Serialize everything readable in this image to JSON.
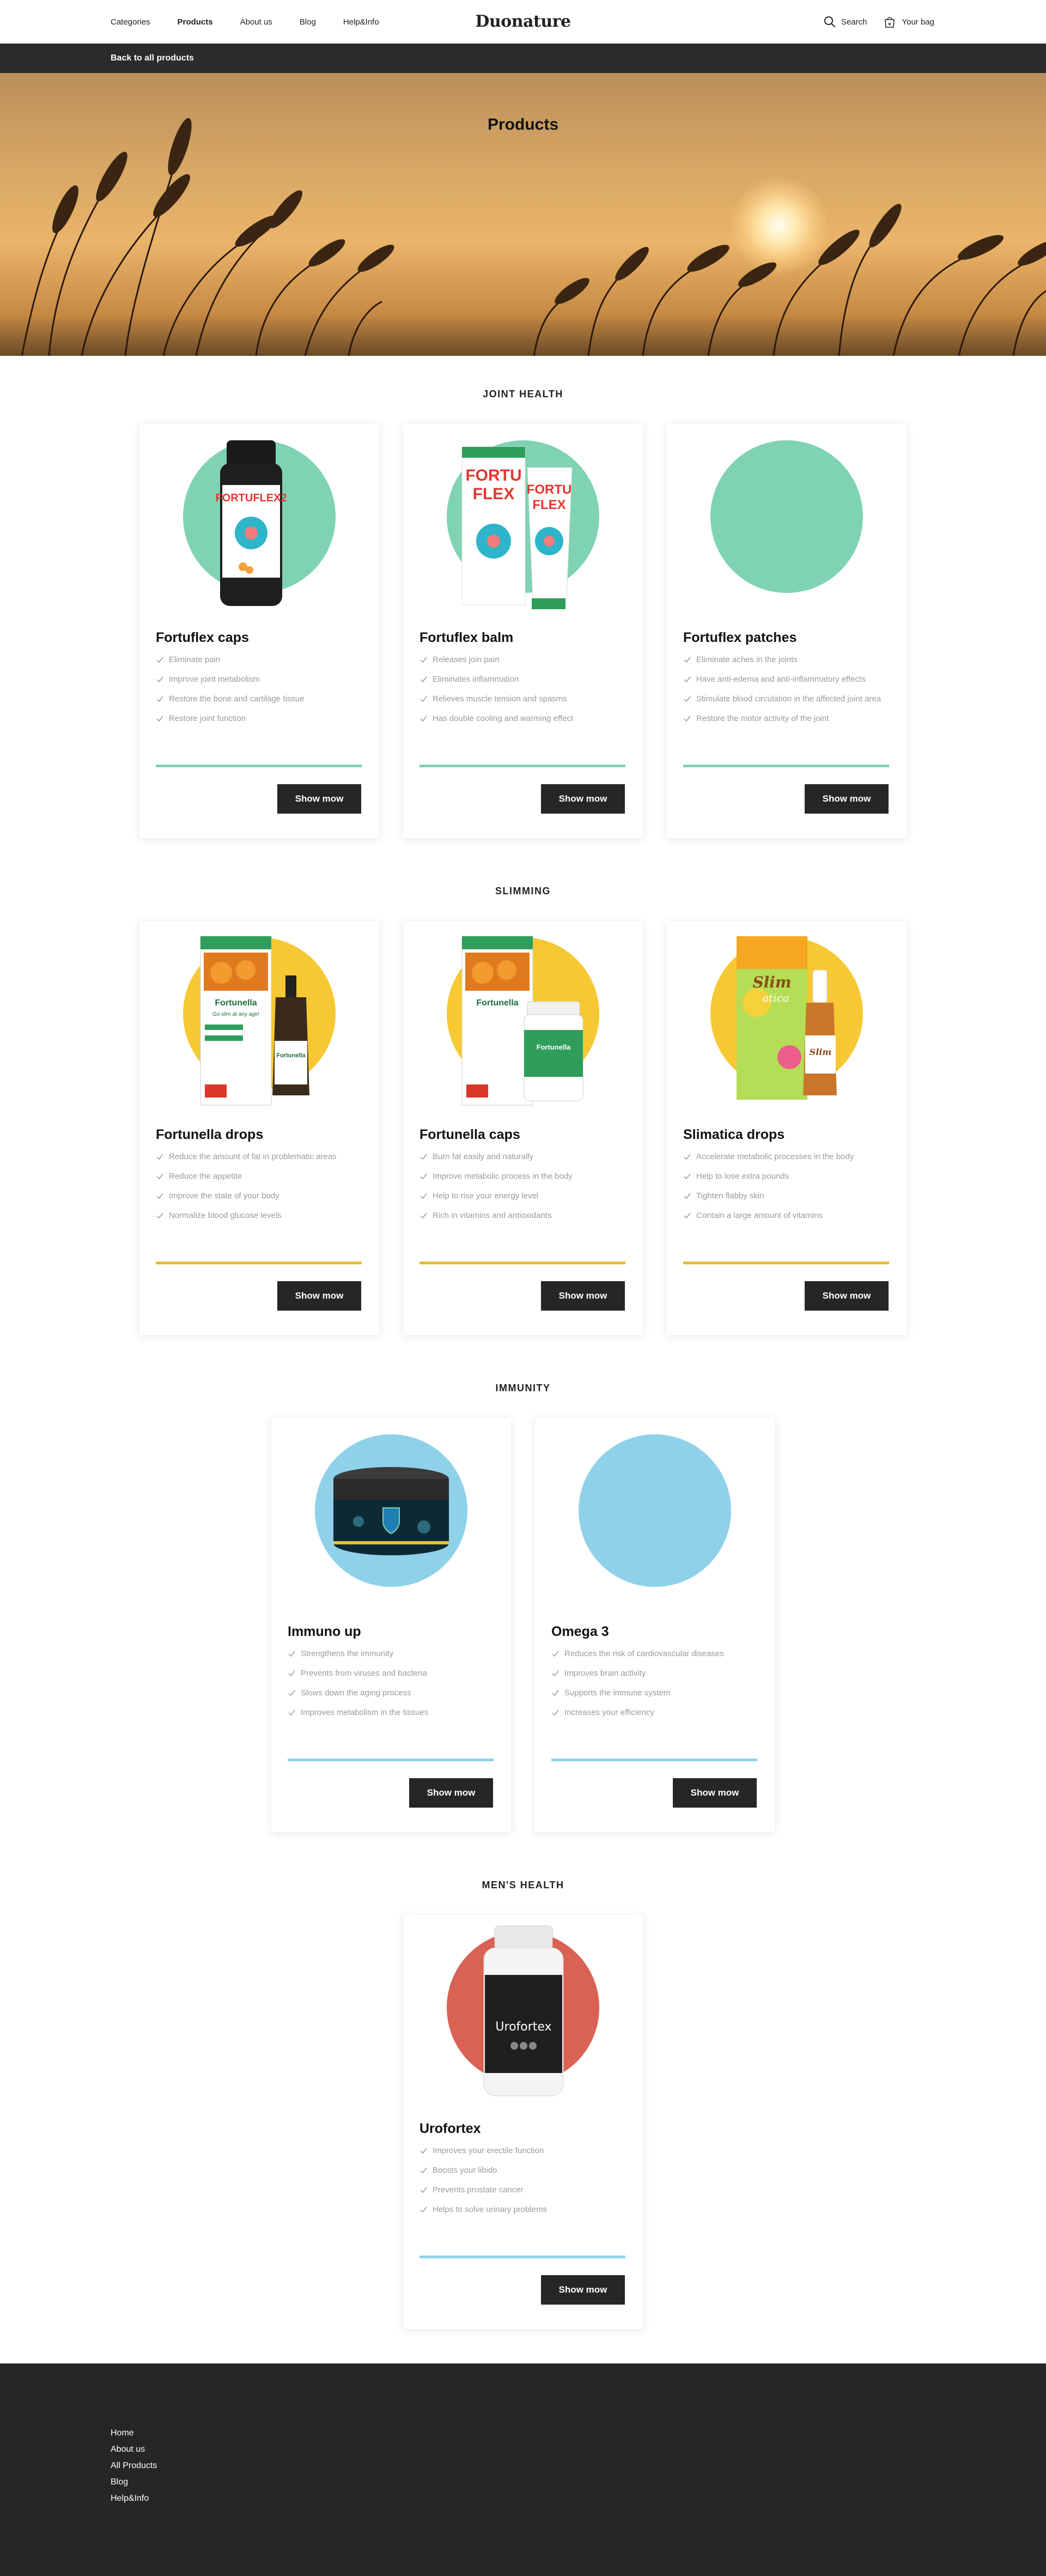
{
  "header": {
    "nav": [
      "Categories",
      "Products",
      "About us",
      "Blog",
      "Help&Info"
    ],
    "active_nav": "Products",
    "logo": "Duonature",
    "search_label": "Search",
    "bag_label": "Your bag"
  },
  "backbar": {
    "label": "Back to all products"
  },
  "hero": {
    "title": "Products"
  },
  "button_label": "Show mow",
  "colors": {
    "joint": "#7fd3b2",
    "slimming": "#f6c833",
    "immunity": "#90d1ea",
    "mens": "#da6254",
    "dark": "#262626"
  },
  "sections": [
    {
      "title": "JOINT HEALTH",
      "products": [
        {
          "name": "Fortuflex caps",
          "features": [
            "Eliminate pain",
            "Improve joint metabolism",
            "Restore the bone and cartilage tissue",
            "Restore joint function"
          ]
        },
        {
          "name": "Fortuflex balm",
          "features": [
            "Releases join pain",
            "Eliminates inflammation",
            "Relieves muscle tension and spasms",
            "Has double cooling and warming effect"
          ]
        },
        {
          "name": "Fortuflex patches",
          "features": [
            "Eliminate aches in the joints",
            "Have anti-edema and anti-inflammatory effects",
            "Stimulate blood circulation in the affected joint area",
            "Restore the motor activity of the joint"
          ]
        }
      ]
    },
    {
      "title": "SLIMMING",
      "products": [
        {
          "name": "Fortunella drops",
          "features": [
            "Reduce the amount of fat in problematic areas",
            "Reduce the appetite",
            "Improve the state of your body",
            "Normalize blood glucose levels"
          ]
        },
        {
          "name": "Fortunella caps",
          "features": [
            "Burn fat easily and naturally",
            "Improve metabolic process in the body",
            "Help to rise your energy level",
            "Rich in vitamins and antioxidants"
          ]
        },
        {
          "name": "Slimatica drops",
          "features": [
            "Accelerate metabolic processes in the body",
            "Help to lose extra pounds",
            "Tighten flabby skin",
            "Contain a large amount of vitamins"
          ]
        }
      ]
    },
    {
      "title": "IMMUNITY",
      "products": [
        {
          "name": "Immuno up",
          "features": [
            "Strengthens the immunity",
            "Prevents from viruses and bacteria",
            "Slows down the aging process",
            "Improves metabolism in the tissues"
          ]
        },
        {
          "name": "Omega 3",
          "features": [
            "Reduces the risk of cardiovascular diseases",
            "Improves brain activity",
            "Supports the immune system",
            "Increases your efficiency"
          ]
        }
      ]
    },
    {
      "title": "MEN'S HEALTH",
      "products": [
        {
          "name": "Urofortex",
          "features": [
            "Improves your erectile function",
            "Boosts your libido",
            "Prevents prostate cancer",
            "Helps to solve urinary problems"
          ]
        }
      ]
    }
  ],
  "product_labels": {
    "fortuflex_caps": [
      "FORTUFLEX2"
    ],
    "fortuflex_balm": [
      "FORTU",
      "FLEX"
    ],
    "fortunella": [
      "Fortunella",
      "Go slim at any age!"
    ],
    "slimatica": [
      "Slim",
      "atica"
    ],
    "urofortex": [
      "Urofortex"
    ]
  },
  "footer": {
    "links": [
      "Home",
      "About us",
      "All Products",
      "Blog",
      "Help&Info"
    ]
  }
}
